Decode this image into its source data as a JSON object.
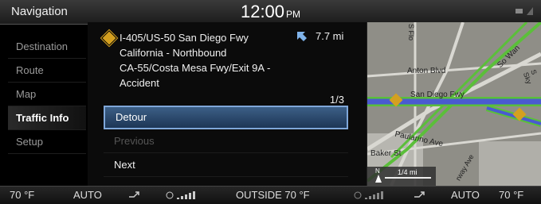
{
  "header": {
    "title": "Navigation",
    "time": "12:00",
    "ampm": "PM"
  },
  "sidebar": {
    "items": [
      {
        "label": "Destination",
        "active": false
      },
      {
        "label": "Route",
        "active": false
      },
      {
        "label": "Map",
        "active": false
      },
      {
        "label": "Traffic Info",
        "active": true
      },
      {
        "label": "Setup",
        "active": false
      }
    ]
  },
  "incident": {
    "lines": [
      "I-405/US-50 San Diego Fwy",
      "California - Northbound",
      "CA-55/Costa Mesa Fwy/Exit 9A -",
      "Accident"
    ],
    "distance": "7.7 mi",
    "pager": "1/3"
  },
  "options": [
    {
      "label": "Detour",
      "state": "selected"
    },
    {
      "label": "Previous",
      "state": "disabled"
    },
    {
      "label": "Next",
      "state": "normal"
    }
  ],
  "map": {
    "streets": [
      "S Flo",
      "Anton Blvd",
      "So Wan",
      "S Sky",
      "San Diego Fwy",
      "Paularino Ave",
      "Baker St",
      "rway Ave"
    ],
    "scale": "1/4 mi",
    "north": "N"
  },
  "bottom": {
    "left_temp": "70 °F",
    "left_mode": "AUTO",
    "outside": "OUTSIDE 70 °F",
    "right_mode": "AUTO",
    "right_temp": "70 °F"
  },
  "colors": {
    "accent": "#3c5f86",
    "warning": "#d4a020",
    "route": "#4a5ad0",
    "highway": "#5bbf3a"
  }
}
